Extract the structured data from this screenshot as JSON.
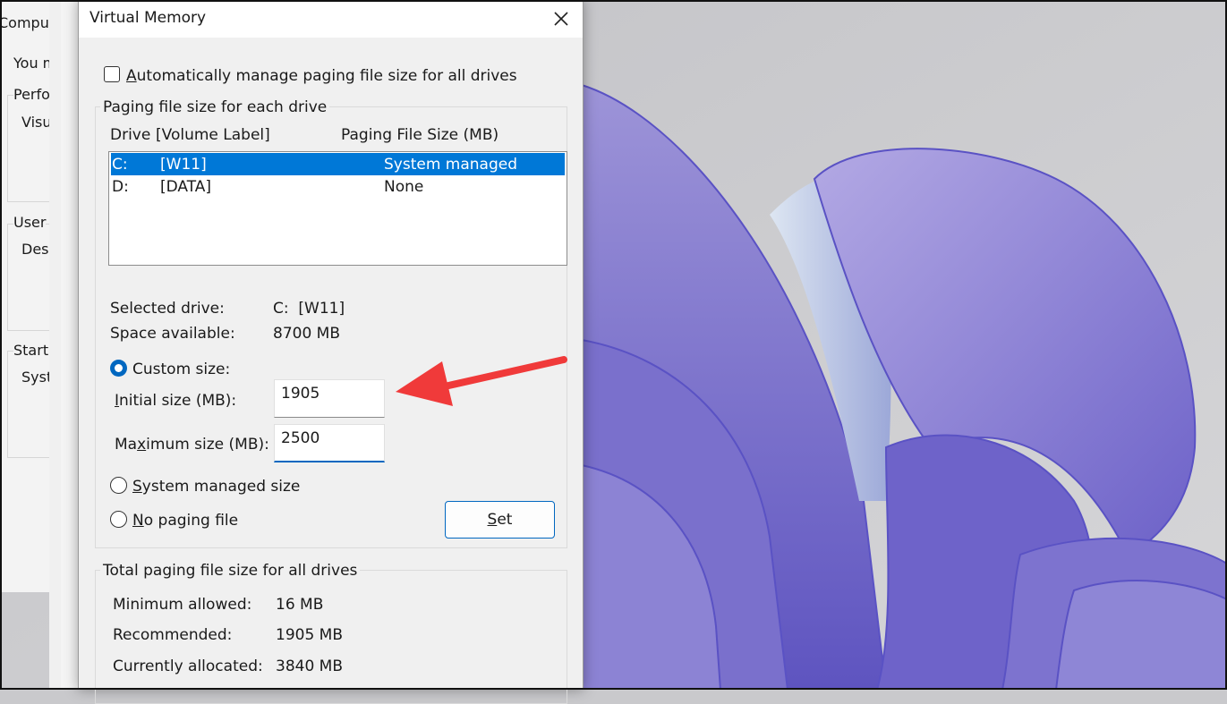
{
  "background_window": {
    "title": "Compute",
    "intro": "You m",
    "group1": "Perfo",
    "group1_item": "Visu",
    "group2": "User",
    "group2_item": "Desk",
    "group3": "Startu",
    "group3_item": "Syst"
  },
  "dialog": {
    "title": "Virtual Memory",
    "auto_manage_label": "Automatically manage paging file size for all drives",
    "auto_manage_checked": false,
    "paging_group_title": "Paging file size for each drive",
    "columns": {
      "drive": "Drive",
      "volume": "[Volume Label]",
      "size": "Paging File Size (MB)"
    },
    "drives": [
      {
        "drive": "C:",
        "label": "[W11]",
        "size": "System managed",
        "selected": true
      },
      {
        "drive": "D:",
        "label": "[DATA]",
        "size": "None",
        "selected": false
      }
    ],
    "selected_drive_label": "Selected drive:",
    "selected_drive_value": "C:  [W11]",
    "space_available_label": "Space available:",
    "space_available_value": "8700 MB",
    "custom_size_label": "Custom size:",
    "initial_size_label": "Initial size (MB):",
    "initial_size_value": "1905",
    "maximum_size_label": "Maximum size (MB):",
    "maximum_size_value": "2500",
    "system_managed_label": "System managed size",
    "no_paging_label": "No paging file",
    "set_button": "Set",
    "total_group_title": "Total paging file size for all drives",
    "minimum_allowed_label": "Minimum allowed:",
    "minimum_allowed_value": "16 MB",
    "recommended_label": "Recommended:",
    "recommended_value": "1905 MB",
    "currently_allocated_label": "Currently allocated:",
    "currently_allocated_value": "3840 MB"
  },
  "colors": {
    "accent": "#0067c0",
    "selection": "#0078d7",
    "arrow": "#f03a3a"
  },
  "icons": {
    "close": "close-icon",
    "annotation": "red-arrow-icon"
  }
}
